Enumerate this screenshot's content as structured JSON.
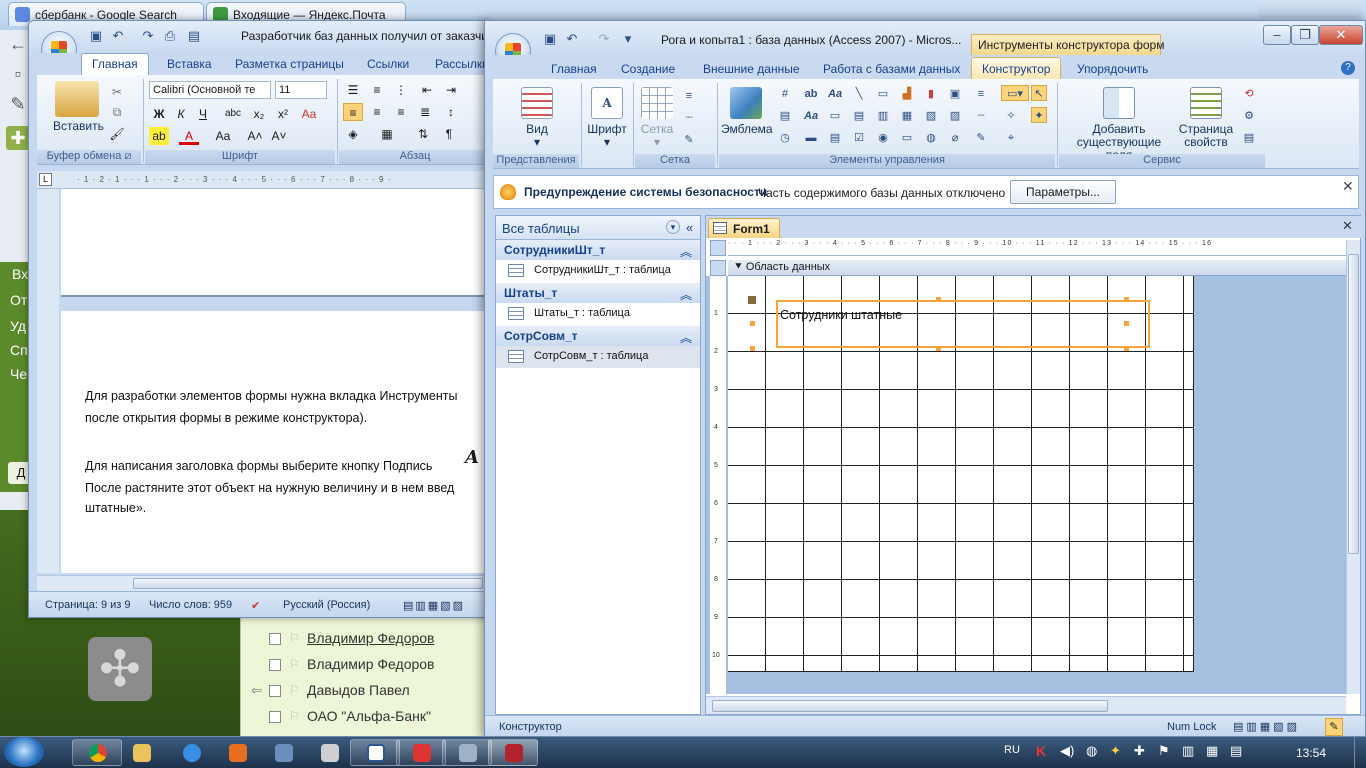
{
  "browser": {
    "tabs": [
      {
        "label": "сбербанк - Google Search",
        "color": "#5b8ae0"
      },
      {
        "label": "Входящие — Яндекс.Почта",
        "color": "#3d9a43"
      }
    ]
  },
  "mail": {
    "sidebar_items": [
      "Вх",
      "От",
      "Уд",
      "Сп",
      "Че"
    ],
    "sidebar_btn": "Д",
    "rows": [
      {
        "name": "Владимир Федоров",
        "underline": true
      },
      {
        "name": "Владимир Федоров",
        "underline": false
      },
      {
        "name": "Давыдов Павел",
        "underline": false
      },
      {
        "name": "ОАО \"Альфа-Банк\"",
        "underline": false
      }
    ]
  },
  "word": {
    "title": "Разработчик баз данных получил от заказчика",
    "tabs": [
      "Главная",
      "Вставка",
      "Разметка страницы",
      "Ссылки",
      "Рассылки"
    ],
    "active_tab": "Главная",
    "paste_label": "Вставить",
    "font_name": "Calibri (Основной те",
    "font_size": "11",
    "groups": [
      "Буфер обмена",
      "Шрифт",
      "Абзац"
    ],
    "paragraphs": [
      "Для разработки элементов формы нужна вкладка Инструменты",
      "после открытия формы в режиме конструктора).",
      "Для написания заголовка формы выберите кнопку Подпись",
      "После растяните этот объект на нужную величину и в нем введ",
      "штатные»."
    ],
    "status": {
      "page": "Страница: 9 из 9",
      "words": "Число слов: 959",
      "lang": "Русский (Россия)"
    }
  },
  "access": {
    "title": "Рога и копыта1 : база данных (Access 2007) - Micros...",
    "context_tab": "Инструменты конструктора форм",
    "tabs": [
      "Главная",
      "Создание",
      "Внешние данные",
      "Работа с базами данных",
      "Конструктор",
      "Упорядочить"
    ],
    "active_tab": "Конструктор",
    "ribbon": {
      "view": "Вид",
      "font": "Шрифт",
      "grid": "Сетка",
      "logo": "Эмблема",
      "add_fields": "Добавить существующие поля",
      "props": "Страница свойств",
      "groups": [
        "Представления",
        "Сетка",
        "Элементы управления",
        "Сервис"
      ]
    },
    "security": {
      "title": "Предупреждение системы безопасности",
      "message": "Часть содержимого базы данных отключено",
      "button": "Параметры..."
    },
    "nav": {
      "header": "Все таблицы",
      "groups": [
        {
          "name": "СотрудникиШт_т",
          "item": "СотрудникиШт_т : таблица"
        },
        {
          "name": "Штаты_т",
          "item": "Штаты_т : таблица"
        },
        {
          "name": "СотрСовм_т",
          "item": "СотрСовм_т : таблица"
        }
      ]
    },
    "form": {
      "tab": "Form1",
      "section": "Область данных",
      "label_text": "Сотрудники штатные"
    },
    "status": {
      "left": "Конструктор",
      "right": "Num Lock"
    }
  },
  "taskbar": {
    "lang": "RU",
    "time": "13:54"
  }
}
